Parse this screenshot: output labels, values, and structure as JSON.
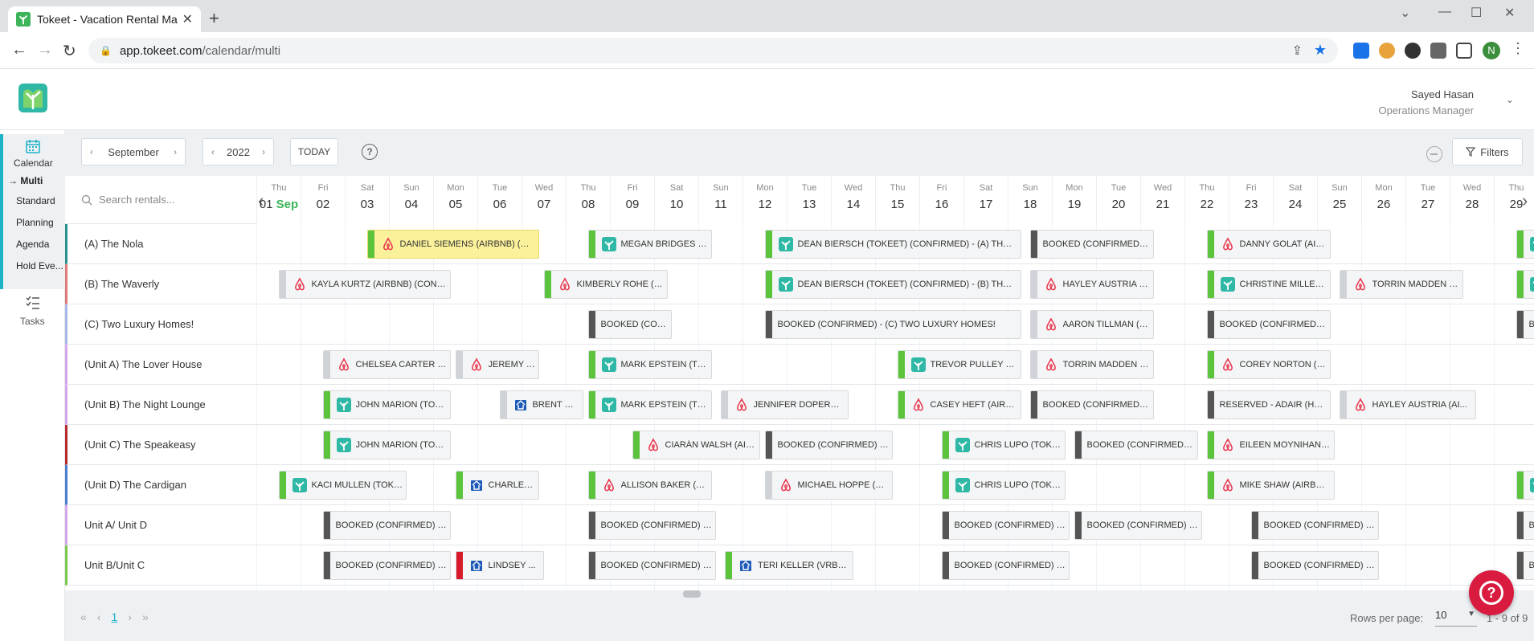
{
  "browser": {
    "tab_title": "Tokeet - Vacation Rental Manager",
    "url_host": "app.tokeet.com",
    "url_path": "/calendar/multi",
    "profile_initial": "N"
  },
  "header": {
    "user_name": "Sayed Hasan",
    "user_role": "Operations Manager"
  },
  "sidebar": {
    "calendar_label": "Calendar",
    "items": [
      "Multi",
      "Standard",
      "Planning",
      "Agenda",
      "Hold Eve..."
    ],
    "tasks_label": "Tasks"
  },
  "controls": {
    "month": "September",
    "year": "2022",
    "today": "TODAY",
    "help": "?",
    "filters": "Filters",
    "search_placeholder": "Search rentals..."
  },
  "days": [
    {
      "w": "Thu",
      "d": "01",
      "m": "Sep"
    },
    {
      "w": "Fri",
      "d": "02"
    },
    {
      "w": "Sat",
      "d": "03"
    },
    {
      "w": "Sun",
      "d": "04"
    },
    {
      "w": "Mon",
      "d": "05"
    },
    {
      "w": "Tue",
      "d": "06"
    },
    {
      "w": "Wed",
      "d": "07"
    },
    {
      "w": "Thu",
      "d": "08"
    },
    {
      "w": "Fri",
      "d": "09"
    },
    {
      "w": "Sat",
      "d": "10"
    },
    {
      "w": "Sun",
      "d": "11"
    },
    {
      "w": "Mon",
      "d": "12"
    },
    {
      "w": "Tue",
      "d": "13"
    },
    {
      "w": "Wed",
      "d": "14"
    },
    {
      "w": "Thu",
      "d": "15"
    },
    {
      "w": "Fri",
      "d": "16"
    },
    {
      "w": "Sat",
      "d": "17"
    },
    {
      "w": "Sun",
      "d": "18"
    },
    {
      "w": "Mon",
      "d": "19"
    },
    {
      "w": "Tue",
      "d": "20"
    },
    {
      "w": "Wed",
      "d": "21"
    },
    {
      "w": "Thu",
      "d": "22"
    },
    {
      "w": "Fri",
      "d": "23"
    },
    {
      "w": "Sat",
      "d": "24"
    },
    {
      "w": "Sun",
      "d": "25"
    },
    {
      "w": "Mon",
      "d": "26"
    },
    {
      "w": "Tue",
      "d": "27"
    },
    {
      "w": "Wed",
      "d": "28"
    },
    {
      "w": "Thu",
      "d": "29"
    }
  ],
  "rentals": [
    {
      "name": "(A) The Nola",
      "color": "#2a8f8f"
    },
    {
      "name": "(B) The Waverly",
      "color": "#e07a7a"
    },
    {
      "name": "(C) Two Luxury Homes!",
      "color": "#a7b8e8"
    },
    {
      "name": "(Unit A) The Lover House",
      "color": "#d6a7e8"
    },
    {
      "name": "(Unit B) The Night Lounge",
      "color": "#d6a7e8"
    },
    {
      "name": "(Unit C) The Speakeasy",
      "color": "#b52a2a"
    },
    {
      "name": "(Unit D) The Cardigan",
      "color": "#4a7fd0"
    },
    {
      "name": "Unit A/ Unit D",
      "color": "#d6a7e8"
    },
    {
      "name": "Unit B/Unit C",
      "color": "#7ac94a"
    }
  ],
  "status_colors": {
    "green": "#5cc43c",
    "gray": "#cfd2d6",
    "dark": "#555555",
    "red": "#d81b2a"
  },
  "bookings": [
    {
      "row": 0,
      "start": 2.5,
      "end": 6.4,
      "text": "DANIEL SIEMENS (AIRBNB) (CON...",
      "icon": "airbnb",
      "bar": "green",
      "hl": true
    },
    {
      "row": 0,
      "start": 7.5,
      "end": 10.3,
      "text": "MEGAN BRIDGES (TO...",
      "icon": "tokeet",
      "bar": "green"
    },
    {
      "row": 0,
      "start": 11.5,
      "end": 17.3,
      "text": "DEAN BIERSCH (TOKEET) (CONFIRMED) - (A) THE NOLA",
      "icon": "tokeet",
      "bar": "green"
    },
    {
      "row": 0,
      "start": 17.5,
      "end": 20.3,
      "text": "BOOKED (CONFIRMED) - (U...",
      "icon": "none",
      "bar": "dark"
    },
    {
      "row": 0,
      "start": 21.5,
      "end": 24.3,
      "text": "DANNY GOLAT (AIRB...",
      "icon": "airbnb",
      "bar": "green"
    },
    {
      "row": 0,
      "start": 28.5,
      "end": 29.5,
      "text": "",
      "icon": "tokeet",
      "bar": "green"
    },
    {
      "row": 1,
      "start": 0.5,
      "end": 4.4,
      "text": "KAYLA KURTZ (AIRBNB) (CONFIR...",
      "icon": "airbnb",
      "bar": "gray"
    },
    {
      "row": 1,
      "start": 6.5,
      "end": 9.3,
      "text": "KIMBERLY ROHE (AIR...",
      "icon": "airbnb",
      "bar": "green"
    },
    {
      "row": 1,
      "start": 11.5,
      "end": 17.3,
      "text": "DEAN BIERSCH (TOKEET) (CONFIRMED) - (B) THE WAVE...",
      "icon": "tokeet",
      "bar": "green"
    },
    {
      "row": 1,
      "start": 17.5,
      "end": 20.3,
      "text": "HAYLEY AUSTRIA (AIR...",
      "icon": "airbnb",
      "bar": "gray"
    },
    {
      "row": 1,
      "start": 21.5,
      "end": 24.3,
      "text": "CHRISTINE MILLER (T...",
      "icon": "tokeet",
      "bar": "green"
    },
    {
      "row": 1,
      "start": 24.5,
      "end": 27.3,
      "text": "TORRIN MADDEN (AI...",
      "icon": "airbnb",
      "bar": "gray"
    },
    {
      "row": 1,
      "start": 28.5,
      "end": 29.5,
      "text": "",
      "icon": "tokeet",
      "bar": "green"
    },
    {
      "row": 2,
      "start": 7.5,
      "end": 9.4,
      "text": "BOOKED (CONFI...",
      "icon": "none",
      "bar": "dark"
    },
    {
      "row": 2,
      "start": 11.5,
      "end": 17.3,
      "text": "BOOKED (CONFIRMED) - (C) TWO LUXURY HOMES!",
      "icon": "none",
      "bar": "dark"
    },
    {
      "row": 2,
      "start": 17.5,
      "end": 20.3,
      "text": "AARON TILLMAN (AIR...",
      "icon": "airbnb",
      "bar": "gray"
    },
    {
      "row": 2,
      "start": 21.5,
      "end": 24.3,
      "text": "BOOKED (CONFIRMED) - (C...",
      "icon": "none",
      "bar": "dark"
    },
    {
      "row": 2,
      "start": 28.5,
      "end": 29.5,
      "text": "BO",
      "icon": "none",
      "bar": "dark"
    },
    {
      "row": 3,
      "start": 1.5,
      "end": 4.4,
      "text": "CHELSEA CARTER (AI...",
      "icon": "airbnb",
      "bar": "gray"
    },
    {
      "row": 3,
      "start": 4.5,
      "end": 6.4,
      "text": "JEREMY T...",
      "icon": "airbnb",
      "bar": "gray"
    },
    {
      "row": 3,
      "start": 7.5,
      "end": 10.3,
      "text": "MARK EPSTEIN (TOK...",
      "icon": "tokeet",
      "bar": "green"
    },
    {
      "row": 3,
      "start": 14.5,
      "end": 17.3,
      "text": "TREVOR PULLEY (TO...",
      "icon": "tokeet",
      "bar": "green"
    },
    {
      "row": 3,
      "start": 17.5,
      "end": 20.3,
      "text": "TORRIN MADDEN (AI...",
      "icon": "airbnb",
      "bar": "gray"
    },
    {
      "row": 3,
      "start": 21.5,
      "end": 24.3,
      "text": "COREY NORTON (AIR...",
      "icon": "airbnb",
      "bar": "green"
    },
    {
      "row": 4,
      "start": 1.5,
      "end": 4.4,
      "text": "JOHN MARION (TOKE...",
      "icon": "tokeet",
      "bar": "green"
    },
    {
      "row": 4,
      "start": 5.5,
      "end": 7.4,
      "text": "BRENT CA...",
      "icon": "vrbo",
      "bar": "gray"
    },
    {
      "row": 4,
      "start": 7.5,
      "end": 10.3,
      "text": "MARK EPSTEIN (TOK...",
      "icon": "tokeet",
      "bar": "green"
    },
    {
      "row": 4,
      "start": 10.5,
      "end": 13.4,
      "text": "JENNIFER DOPERAK (...",
      "icon": "airbnb",
      "bar": "gray"
    },
    {
      "row": 4,
      "start": 14.5,
      "end": 17.3,
      "text": "CASEY HEFT (AIRBNB...",
      "icon": "airbnb",
      "bar": "green"
    },
    {
      "row": 4,
      "start": 17.5,
      "end": 20.3,
      "text": "BOOKED (CONFIRMED) - U...",
      "icon": "none",
      "bar": "dark"
    },
    {
      "row": 4,
      "start": 21.5,
      "end": 24.3,
      "text": "RESERVED - ADAIR (HOME...",
      "icon": "none",
      "bar": "dark"
    },
    {
      "row": 4,
      "start": 24.5,
      "end": 27.6,
      "text": "HAYLEY AUSTRIA (AI...",
      "icon": "airbnb",
      "bar": "gray"
    },
    {
      "row": 5,
      "start": 1.5,
      "end": 4.4,
      "text": "JOHN MARION (TOKE...",
      "icon": "tokeet",
      "bar": "green"
    },
    {
      "row": 5,
      "start": 8.5,
      "end": 11.4,
      "text": "CIARÁN WALSH (AIRB...",
      "icon": "airbnb",
      "bar": "green"
    },
    {
      "row": 5,
      "start": 11.5,
      "end": 14.4,
      "text": "BOOKED (CONFIRMED) - U...",
      "icon": "none",
      "bar": "dark"
    },
    {
      "row": 5,
      "start": 15.5,
      "end": 18.3,
      "text": "CHRIS LUPO (TOKEET)...",
      "icon": "tokeet",
      "bar": "green"
    },
    {
      "row": 5,
      "start": 18.5,
      "end": 21.3,
      "text": "BOOKED (CONFIRMED) - (U...",
      "icon": "none",
      "bar": "dark"
    },
    {
      "row": 5,
      "start": 21.5,
      "end": 24.4,
      "text": "EILEEN MOYNIHAN (A...",
      "icon": "airbnb",
      "bar": "green"
    },
    {
      "row": 6,
      "start": 0.5,
      "end": 3.4,
      "text": "KACI MULLEN (TOKEE...",
      "icon": "tokeet",
      "bar": "green"
    },
    {
      "row": 6,
      "start": 4.5,
      "end": 6.4,
      "text": "CHARLES ...",
      "icon": "vrbo",
      "bar": "green"
    },
    {
      "row": 6,
      "start": 7.5,
      "end": 10.3,
      "text": "ALLISON BAKER (AIR...",
      "icon": "airbnb",
      "bar": "green"
    },
    {
      "row": 6,
      "start": 11.5,
      "end": 14.4,
      "text": "MICHAEL HOPPE (AIR...",
      "icon": "airbnb",
      "bar": "gray"
    },
    {
      "row": 6,
      "start": 15.5,
      "end": 18.3,
      "text": "CHRIS LUPO (TOKEET)...",
      "icon": "tokeet",
      "bar": "green"
    },
    {
      "row": 6,
      "start": 21.5,
      "end": 24.4,
      "text": "MIKE SHAW (AIRBNB)...",
      "icon": "airbnb",
      "bar": "green"
    },
    {
      "row": 6,
      "start": 28.5,
      "end": 29.5,
      "text": "",
      "icon": "tokeet",
      "bar": "green"
    },
    {
      "row": 7,
      "start": 1.5,
      "end": 4.4,
      "text": "BOOKED (CONFIRMED) - U...",
      "icon": "none",
      "bar": "dark"
    },
    {
      "row": 7,
      "start": 7.5,
      "end": 10.4,
      "text": "BOOKED (CONFIRMED) - U...",
      "icon": "none",
      "bar": "dark"
    },
    {
      "row": 7,
      "start": 15.5,
      "end": 18.4,
      "text": "BOOKED (CONFIRMED) - U...",
      "icon": "none",
      "bar": "dark"
    },
    {
      "row": 7,
      "start": 18.5,
      "end": 21.4,
      "text": "BOOKED (CONFIRMED) - U...",
      "icon": "none",
      "bar": "dark"
    },
    {
      "row": 7,
      "start": 22.5,
      "end": 25.4,
      "text": "BOOKED (CONFIRMED) - U...",
      "icon": "none",
      "bar": "dark"
    },
    {
      "row": 7,
      "start": 28.5,
      "end": 29.5,
      "text": "BO",
      "icon": "none",
      "bar": "dark"
    },
    {
      "row": 8,
      "start": 1.5,
      "end": 4.4,
      "text": "BOOKED (CONFIRMED) - U...",
      "icon": "none",
      "bar": "dark"
    },
    {
      "row": 8,
      "start": 4.5,
      "end": 6.5,
      "text": "LINDSEY ...",
      "icon": "vrbo",
      "bar": "red"
    },
    {
      "row": 8,
      "start": 7.5,
      "end": 10.4,
      "text": "BOOKED (CONFIRMED) - U...",
      "icon": "none",
      "bar": "dark"
    },
    {
      "row": 8,
      "start": 10.6,
      "end": 13.5,
      "text": "TERI KELLER (VRBO) (...",
      "icon": "vrbo",
      "bar": "green"
    },
    {
      "row": 8,
      "start": 15.5,
      "end": 18.4,
      "text": "BOOKED (CONFIRMED) - U...",
      "icon": "none",
      "bar": "dark"
    },
    {
      "row": 8,
      "start": 22.5,
      "end": 25.4,
      "text": "BOOKED (CONFIRMED) - U...",
      "icon": "none",
      "bar": "dark"
    },
    {
      "row": 8,
      "start": 28.5,
      "end": 29.5,
      "text": "BO",
      "icon": "none",
      "bar": "dark"
    }
  ],
  "pagination": {
    "page": "1",
    "rows_per_page_label": "Rows per page:",
    "rows_per_page": "10",
    "range": "1 - 9 of 9"
  }
}
